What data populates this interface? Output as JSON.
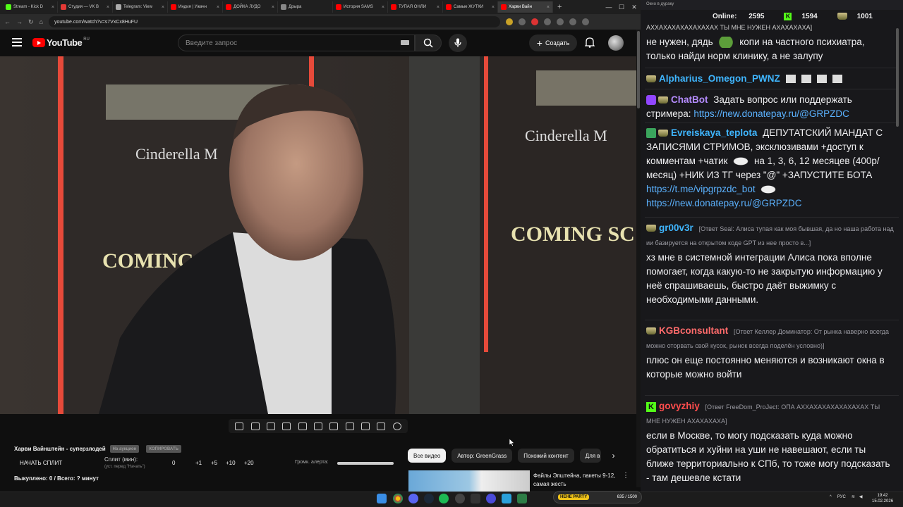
{
  "browser": {
    "tabs": [
      {
        "label": "Stream - Kick D",
        "color": "#53fc18"
      },
      {
        "label": "Студия — VK В",
        "color": "#e53935"
      },
      {
        "label": "Telegram: View",
        "color": "#aaaaaa"
      },
      {
        "label": "Индия | Ужачн",
        "color": "#ff0000"
      },
      {
        "label": "ДОЙКА ЛУДО",
        "color": "#ff0000"
      },
      {
        "label": "Дрыра",
        "color": "#888888"
      },
      {
        "label": "История SAMS",
        "color": "#ff0000"
      },
      {
        "label": "ТУПАЯ ОНЛИ",
        "color": "#ff0000"
      },
      {
        "label": "Самые ЖУТКИ",
        "color": "#ff0000"
      },
      {
        "label": "Харви Вайн",
        "color": "#ff0000"
      }
    ],
    "url": "youtube.com/watch?v=s7VxCx8HuFU"
  },
  "youtube": {
    "logo_text": "YouTube",
    "logo_region": "RU",
    "search_placeholder": "Введите запрос",
    "create_label": "Создать"
  },
  "split": {
    "title": "Харви Вайнштейн - суперзлодей",
    "badge_auction": "На аукцион",
    "badge_copy": "КОПИРОВАТЬ",
    "start_label": "НАЧАТЬ СПЛИТ",
    "split_label": "Сплит (мин):",
    "split_hint": "(уст. перед \"Начать\")",
    "value": "0",
    "plus1": "+1",
    "plus5": "+5",
    "plus10": "+10",
    "plus20": "+20",
    "alert_label": "Громк. алерта:",
    "bought": "Выкуплено: 0 / Всего: ? минут"
  },
  "chips": [
    "Все видео",
    "Автор: GreenGrass",
    "Похожий контент",
    "Для в"
  ],
  "recommendation": {
    "title": "Файлы Эпштейна, пакеты 9-12, самая жесть"
  },
  "chat": {
    "topbar": "Окно в дураку",
    "online_label": "Online:",
    "online_value": "2595",
    "kick_value": "1594",
    "crown_value": "1001",
    "messages": [
      {
        "text_top": "АХХАХАХАХАХАХАХАХ ТЫ МНЕ НУЖЕН АХАХАХАХА]"
      },
      {
        "text": "не нужен, дядь",
        "text2": "копи на частного психиатра, только найди норм клинику, а не залупу"
      },
      {
        "user": "Alpharius_Omegon_PWNZ",
        "color": "#3fb6ff"
      },
      {
        "user": "ChatBot",
        "color": "#b58cff",
        "text": "Задать вопрос или поддержать стримера:",
        "link": "https://new.donatepay.ru/@GRPZDC"
      },
      {
        "user": "Evreiskaya_teplota",
        "color": "#3fb6ff",
        "text": "ДЕПУТАТСКИЙ МАНДАТ С ЗАПИСЯМИ СТРИМОВ, эксклюзивами +доступ к комментам +чатик",
        "text2": "на 1, 3, 6, 12 месяцев (400р/месяц) +НИК ИЗ ТГ через \"@\" +ЗАПУСТИТЕ БОТА",
        "link": "https://t.me/vipgrpzdc_bot",
        "link2": "https://new.donatepay.ru/@GRPZDC"
      },
      {
        "user": "gr00v3r",
        "color": "#3fb6ff",
        "reply": "[Ответ Seal: Алиса тупая как моя бывшая, да но наша работа над ии базируется на открытом коде GPT из нее просто в...]",
        "text": "хз мне в системной интеграции Алиса пока вполне помогает, когда какую-то не закрытую информацию у неё спрашиваешь, быстро даёт выжимку с необходимыми данными."
      },
      {
        "user": "KGBconsultant",
        "color": "#ff6b6b",
        "reply": "[Ответ Келлер Доминатор: От рынка наверно всегда можно оторвать свой кусок, рынок всегда поделён условно)]",
        "text": "плюс он еще постоянно меняются и возникают окна в которые можно войти"
      },
      {
        "user": "govyzhiy",
        "color": "#ff4d4d",
        "reply": "[Ответ FreeDom_ProJect: ОПА АХХАХАХАХАХАХАХАХ ТЫ МНЕ НУЖЕН АХАХАХАХА]",
        "text": "если в Москве, то могу подсказать куда можно обратиться и хуйни на уши не навешают, если ты ближе территориально к СПб, то тоже могу подсказать - там дешевле кстати"
      }
    ]
  },
  "taskbar": {
    "party_label": "HEHE PARTY",
    "party_value": "635 / 1500",
    "lang": "РУС",
    "time": "19:42",
    "date": "15.02.2026"
  }
}
